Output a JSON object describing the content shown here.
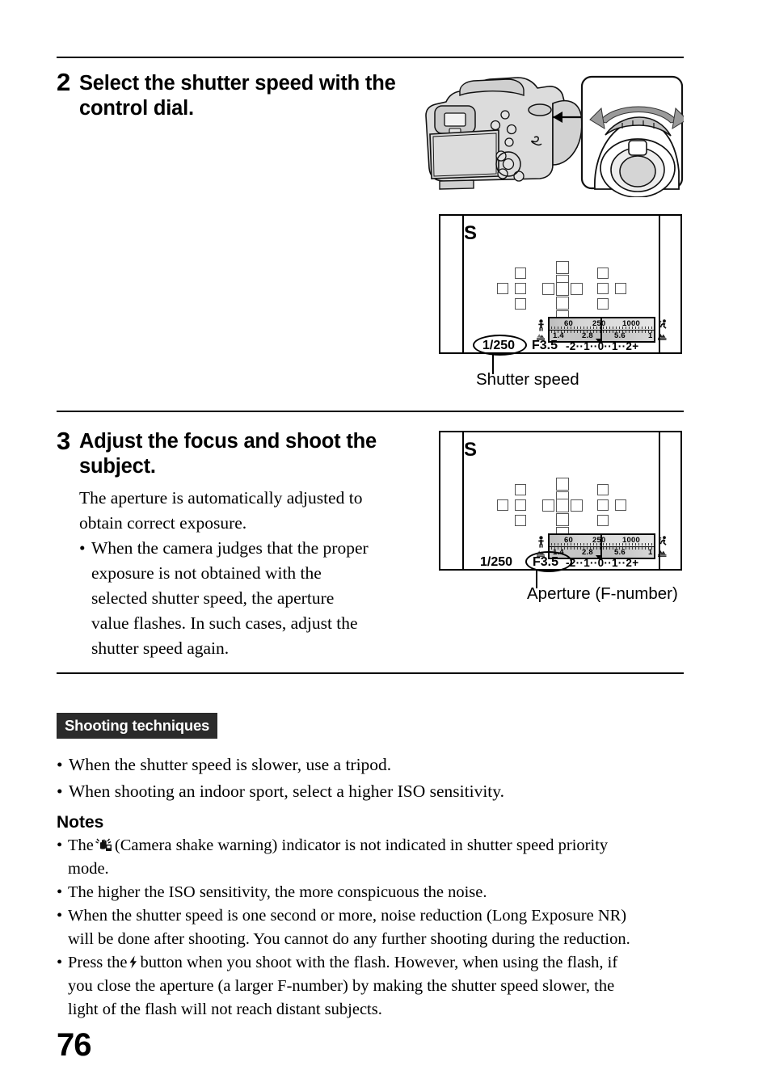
{
  "page": {
    "number": "76"
  },
  "steps": [
    {
      "number": "2",
      "heading_line1": "Select the shutter speed with the",
      "heading_line2": "control dial."
    },
    {
      "number": "3",
      "heading_line1": "Adjust the focus and shoot the",
      "heading_line2": "subject.",
      "body_line1": "The aperture is automatically adjusted to",
      "body_line2": "obtain correct exposure.",
      "bullet": {
        "marker": "•",
        "line1": "When the camera judges that the proper",
        "line2": "exposure is not obtained with the",
        "line3": "selected shutter speed, the aperture",
        "line4": "value flashes. In such cases, adjust the",
        "line5": "shutter speed again."
      }
    }
  ],
  "camera_figure": {
    "icon_camera": "dslr-camera-rear-illustration",
    "icon_dial": "control-dial-detail-illustration",
    "icon_rotate_arrow": "rotate-arrow-icon",
    "icon_pointer_arrow": "pointer-arrow-icon"
  },
  "lcd_panels": [
    {
      "mode": "S",
      "shutter_speed": "1/250",
      "aperture": "F3.5",
      "highlighted": "shutter_speed",
      "shutter_scale_labels": [
        "60",
        "250",
        "1000"
      ],
      "aperture_scale_labels": [
        "1.4",
        "2.8",
        "5.6"
      ],
      "exposure_scale": "-2··1··0··1··2+",
      "icon_person": "person-icon",
      "icon_runner": "running-person-icon",
      "icon_landscape_near": "near-landscape-icon",
      "icon_landscape_far": "far-landscape-icon",
      "callout": "Shutter speed"
    },
    {
      "mode": "S",
      "shutter_speed": "1/250",
      "aperture": "F3.5",
      "highlighted": "aperture",
      "shutter_scale_labels": [
        "60",
        "250",
        "1000"
      ],
      "aperture_scale_labels": [
        "1.4",
        "2.8",
        "5.6"
      ],
      "exposure_scale": "-2··1··0··1··2+",
      "icon_person": "person-icon",
      "icon_runner": "running-person-icon",
      "icon_landscape_near": "near-landscape-icon",
      "icon_landscape_far": "far-landscape-icon",
      "callout": "Aperture (F-number)"
    }
  ],
  "shooting_techniques": {
    "banner_label": "Shooting techniques",
    "bullets": [
      {
        "marker": "•",
        "text": "When the shutter speed is slower, use a tripod."
      },
      {
        "marker": "•",
        "text": "When shooting an indoor sport, select a higher ISO sensitivity."
      }
    ]
  },
  "notes": {
    "heading": "Notes",
    "items": [
      {
        "marker": "•",
        "pre": "The",
        "icon": "camera-shake-warning-icon",
        "line1_post": "(Camera shake warning) indicator is not indicated in shutter speed priority",
        "line2": "mode."
      },
      {
        "marker": "•",
        "line1": "The higher the ISO sensitivity, the more conspicuous the noise."
      },
      {
        "marker": "•",
        "line1": "When the shutter speed is one second or more, noise reduction (Long Exposure NR)",
        "line2": "will be done after shooting. You cannot do any further shooting during the reduction."
      },
      {
        "marker": "•",
        "pre": "Press the",
        "icon": "flash-bolt-icon",
        "line1_post": "button when you shoot with the flash. However, when using the flash, if",
        "line2": "you close the aperture (a larger F-number) by making the shutter speed slower, the",
        "line3": "light of the flash will not reach distant subjects."
      }
    ]
  },
  "colors": {
    "ink": "#000000",
    "banner_bg": "#2b2b2b",
    "banner_fg": "#ffffff",
    "scale_fill": "#d9d9d9",
    "af_box_stroke": "#555555"
  }
}
